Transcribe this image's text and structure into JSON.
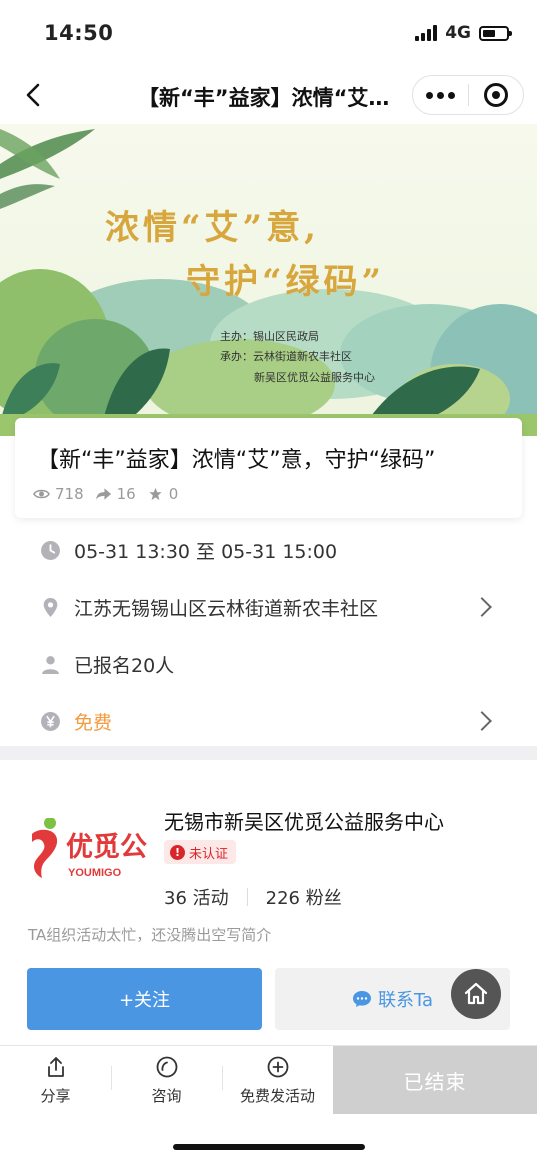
{
  "status": {
    "time": "14:50",
    "network": "4G",
    "battery_level": 0.55
  },
  "nav": {
    "title": "【新“丰”益家】浓情“艾”意，守护“绿码”"
  },
  "banner": {
    "line1": "浓情“艾”意,",
    "line2": "守护“绿码”",
    "host_line": "主办：锡山区民政局",
    "organizer_line": "承办：云林街道新农丰社区",
    "organizer_line2": "新吴区优觅公益服务中心"
  },
  "event": {
    "title": "【新“丰”益家】浓情“艾”意，守护“绿码”",
    "views": "718",
    "shares": "16",
    "stars": "0"
  },
  "info": {
    "time": "05-31 13:30 至 05-31 15:00",
    "location": "江苏无锡锡山区云林街道新农丰社区",
    "signups": "已报名20人",
    "fee": "免费"
  },
  "org": {
    "logo_text": "优觅公",
    "logo_sub": "YOUMIGO",
    "name": "无锡市新吴区优觅公益服务中心",
    "badge": "未认证",
    "activities": "36 活动",
    "fans": "226 粉丝",
    "intro": "TA组织活动太忙，还没腾出空写简介",
    "follow_label": "+关注",
    "contact_label": "联系Ta"
  },
  "bottom": {
    "share": "分享",
    "consult": "咨询",
    "publish": "免费发活动",
    "ended": "已结束"
  },
  "colors": {
    "accent_blue": "#4a96e2",
    "fee_orange": "#f39b3f",
    "banner_gold": "#d7a63d",
    "alert_red": "#d9262a"
  }
}
